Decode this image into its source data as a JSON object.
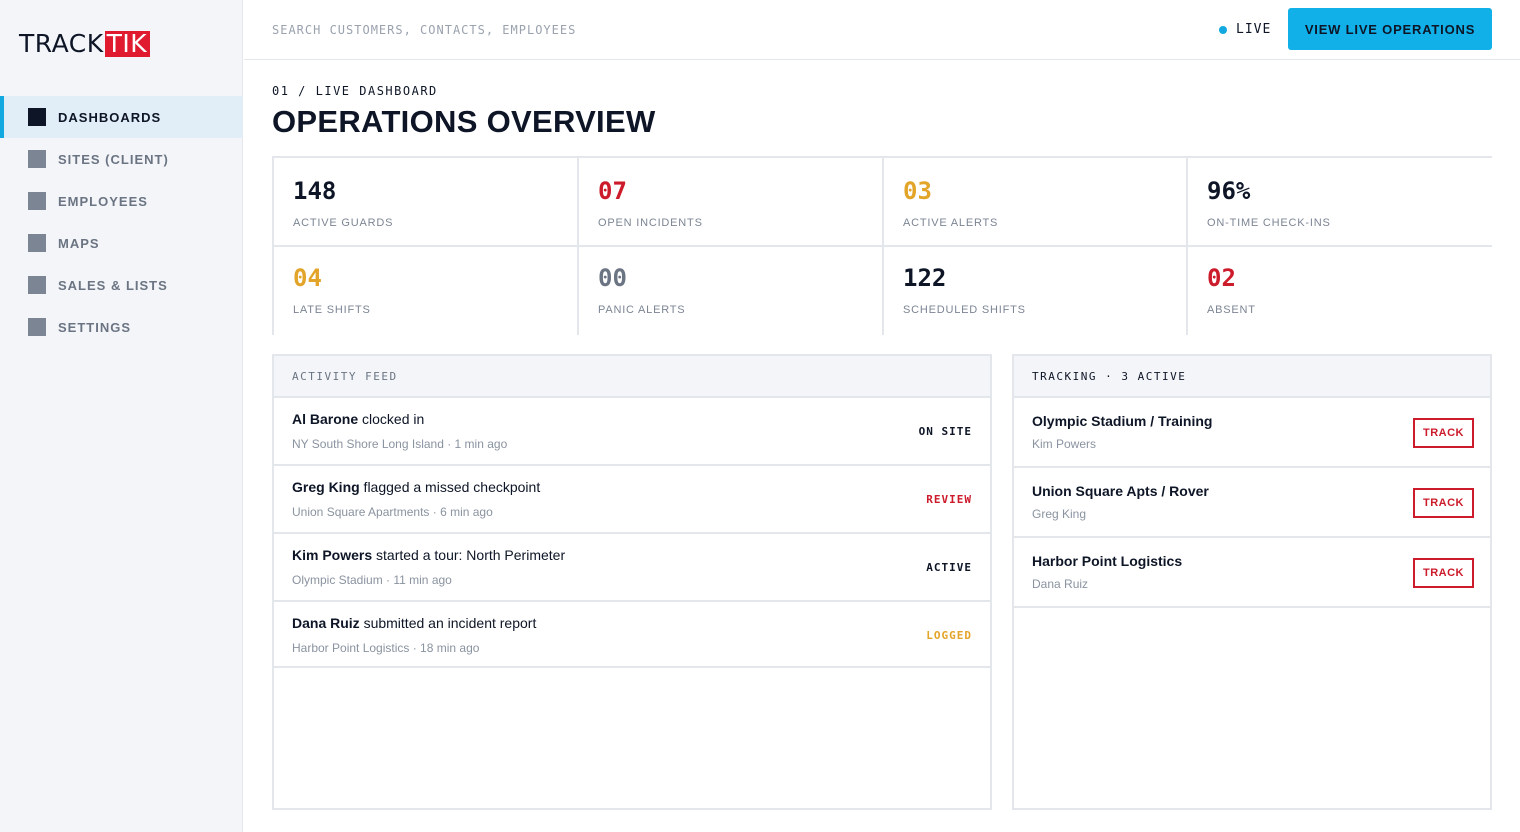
{
  "brand": {
    "logo_left": "TRACK",
    "logo_right": "TIK",
    "accent": "#12a9e1",
    "logo_red": "#e01b2f"
  },
  "sidebar": {
    "items": [
      {
        "label": "DASHBOARDS",
        "active": true
      },
      {
        "label": "SITES (CLIENT)"
      },
      {
        "label": "EMPLOYEES"
      },
      {
        "label": "MAPS"
      },
      {
        "label": "SALES & LISTS"
      },
      {
        "label": "SETTINGS"
      }
    ]
  },
  "topbar": {
    "search_placeholder": "SEARCH CUSTOMERS, CONTACTS, EMPLOYEES",
    "live_label": "LIVE",
    "cta_label": "VIEW LIVE OPERATIONS"
  },
  "page": {
    "breadcrumb": "01 / LIVE DASHBOARD",
    "title": "OPERATIONS OVERVIEW"
  },
  "stats": [
    {
      "value": "148",
      "label": "ACTIVE GUARDS",
      "color": "#0d1526"
    },
    {
      "value": "07",
      "label": "OPEN INCIDENTS",
      "color": "#cc1b2b"
    },
    {
      "value": "03",
      "label": "ACTIVE ALERTS",
      "color": "#e3a42a"
    },
    {
      "value": "96%",
      "label": "ON-TIME CHECK-INS",
      "color": "#0d1526"
    },
    {
      "value": "04",
      "label": "LATE SHIFTS",
      "color": "#e3a42a"
    },
    {
      "value": "00",
      "label": "PANIC ALERTS",
      "color": "#6b7483"
    },
    {
      "value": "122",
      "label": "SCHEDULED SHIFTS",
      "color": "#0d1526"
    },
    {
      "value": "02",
      "label": "ABSENT",
      "color": "#cc1b2b"
    }
  ],
  "activity": {
    "header": "ACTIVITY FEED",
    "items": [
      {
        "name": "Al Barone",
        "action": " clocked in",
        "sub": "NY South Shore Long Island · 1 min ago",
        "badge": "ON SITE",
        "badge_color": "#0d1526"
      },
      {
        "name": "Greg King",
        "action": " flagged a missed checkpoint",
        "sub": "Union Square Apartments · 6 min ago",
        "badge": "REVIEW",
        "badge_color": "#cc1b2b"
      },
      {
        "name": "Kim Powers",
        "action": " started a tour: North Perimeter",
        "sub": "Olympic Stadium · 11 min ago",
        "badge": "ACTIVE",
        "badge_color": "#0d1526"
      },
      {
        "name": "Dana Ruiz",
        "action": " submitted an incident report",
        "sub": "Harbor Point Logistics · 18 min ago",
        "badge": "LOGGED",
        "badge_color": "#e3a42a"
      }
    ]
  },
  "tracking": {
    "header": "TRACKING · 3 ACTIVE",
    "items": [
      {
        "title": "Olympic Stadium / Training",
        "sub": "Kim Powers",
        "button": "TRACK"
      },
      {
        "title": "Union Square Apts / Rover",
        "sub": "Greg King",
        "button": "TRACK"
      },
      {
        "title": "Harbor Point Logistics",
        "sub": "Dana Ruiz",
        "button": "TRACK"
      }
    ]
  }
}
